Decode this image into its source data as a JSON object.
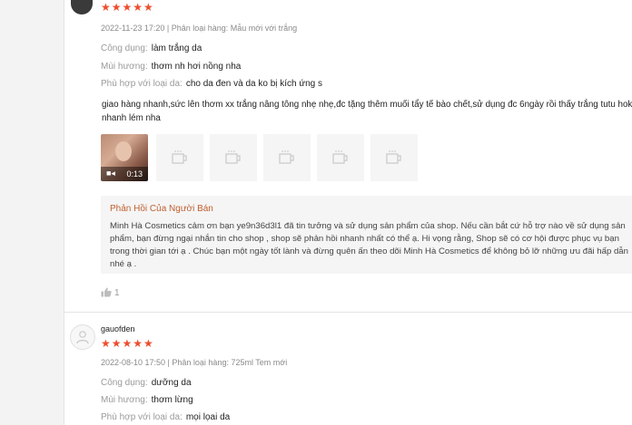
{
  "review1": {
    "stars": "★★★★★",
    "meta": "2022-11-23 17:20 | Phân loại hàng: Mẫu mới với trắng",
    "attrs": [
      {
        "key": "Công dụng:",
        "value": "làm trắng da"
      },
      {
        "key": "Mùi hương:",
        "value": "thơm nh hơi nồng nha"
      },
      {
        "key": "Phù hợp với loại da:",
        "value": "cho da đen và da ko bị kích ứng s"
      }
    ],
    "comment": "giao hàng nhanh,sức lên thơm xx trắng nâng tông nhẹ nhẹ,đc tặng thêm muối tẩy tế bào chết,sử dụng đc 6ngày rồi thấy trắng tutu hok nhanh lém nha",
    "video_duration": "0:13",
    "reply_title": "Phản Hồi Của Người Bán",
    "reply_text": "Minh Hà Cosmetics cảm ơn bạn ye9n36d3l1 đã tin tưởng và sử dụng sản phẩm của shop. Nếu cần bắt cứ hỗ trợ nào về sử dụng sản phẩm, bạn đừng ngại nhắn tin cho shop , shop sẽ phản hồi nhanh nhất có thể ạ. Hi vọng rằng, Shop sẽ có cơ hội được phục vụ bạn trong thời gian tới ạ . Chúc bạn một ngày tốt lành và đừng quên ấn theo dõi Minh Hà Cosmetics để không bỏ lỡ những ưu đãi hấp dẫn nhé ạ .",
    "likes": "1"
  },
  "review2": {
    "username": "gauofden",
    "stars": "★★★★★",
    "meta": "2022-08-10 17:50 | Phân loại hàng: 725ml Tem mới",
    "attrs": [
      {
        "key": "Công dụng:",
        "value": "dưỡng da"
      },
      {
        "key": "Mùi hương:",
        "value": "thơm lừng"
      },
      {
        "key": "Phù hợp với loại da:",
        "value": "mọi lọai da"
      }
    ]
  },
  "colors": {
    "accent": "#ee4d2d",
    "seller_reply_title": "#c06030"
  },
  "icons": [
    "avatar",
    "video-camera-icon",
    "image-placeholder-icon",
    "thumbs-up-icon",
    "default-user-icon"
  ]
}
